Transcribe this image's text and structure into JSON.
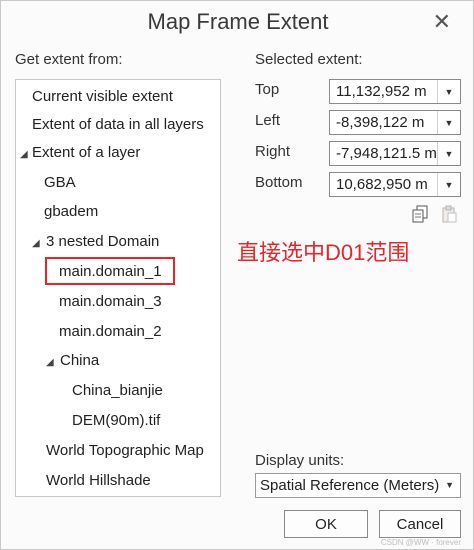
{
  "dialog": {
    "title": "Map Frame Extent",
    "close_glyph": "✕"
  },
  "left": {
    "heading": "Get extent from:",
    "tree": [
      {
        "label": "Current visible extent"
      },
      {
        "label": "Extent of data in all layers"
      },
      {
        "label": "Extent of a layer",
        "expanded": true
      },
      {
        "label": "GBA"
      },
      {
        "label": "gbadem"
      },
      {
        "label": "3 nested Domain",
        "expanded": true
      },
      {
        "label": "main.domain_1",
        "highlighted": true
      },
      {
        "label": "main.domain_3"
      },
      {
        "label": "main.domain_2"
      },
      {
        "label": "China",
        "expanded": true
      },
      {
        "label": "China_bianjie"
      },
      {
        "label": "DEM(90m).tif"
      },
      {
        "label": "World Topographic Map"
      },
      {
        "label": "World Hillshade"
      }
    ]
  },
  "right": {
    "heading": "Selected extent:",
    "fields": [
      {
        "label": "Top",
        "value": "11,132,952 m"
      },
      {
        "label": "Left",
        "value": "-8,398,122 m"
      },
      {
        "label": "Right",
        "value": "-7,948,121.5 m"
      },
      {
        "label": "Bottom",
        "value": "10,682,950 m"
      }
    ],
    "copy_icon": "copy-icon",
    "paste_icon": "paste-icon"
  },
  "annotation": "直接选中D01范围",
  "units": {
    "label": "Display units:",
    "selected": "Spatial Reference (Meters)"
  },
  "buttons": {
    "ok": "OK",
    "cancel": "Cancel"
  },
  "watermark": "CSDN @WW · forever",
  "colors": {
    "annotation": "#e0282a",
    "highlight_border": "#e0282a"
  }
}
